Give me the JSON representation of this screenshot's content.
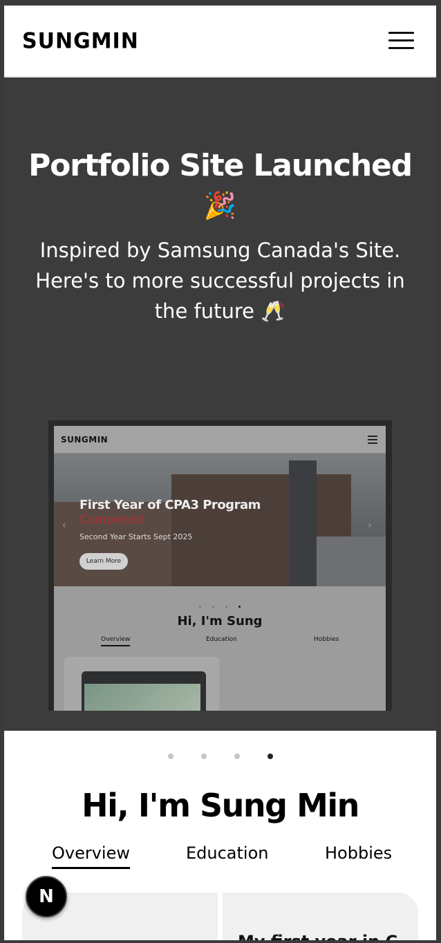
{
  "header": {
    "logo": "SUNGMIN",
    "menu_icon": "hamburger-menu-icon"
  },
  "hero": {
    "title": "Portfolio Site Launched",
    "title_emoji": "🎉",
    "subtitle": "Inspired by Samsung Canada's Site. Here's to more successful projects in the future 🥂"
  },
  "preview": {
    "logo": "SUNGMIN",
    "banner_title": "First Year of CPA3 Program",
    "banner_highlight": "Completed",
    "banner_sub": "Second Year Starts Sept 2025",
    "learn_more": "Learn More",
    "greeting": "Hi, I'm Sung",
    "tabs": [
      "Overview",
      "Education",
      "Hobbies"
    ],
    "active_dot": 4
  },
  "carousel": {
    "dot_count": 4,
    "active_dot": 4
  },
  "intro": {
    "title": "Hi, I'm Sung Min",
    "tabs": [
      "Overview",
      "Education",
      "Hobbies"
    ],
    "active_tab": "Overview",
    "card_text": "My first year in C"
  },
  "dev_badge": {
    "label": "N"
  },
  "colors": {
    "hero_bg": "#3c3c3c",
    "page_bg": "#ffffff",
    "accent": "#000000",
    "card_bg": "#f0f0f0",
    "highlight_red": "#b03030"
  }
}
